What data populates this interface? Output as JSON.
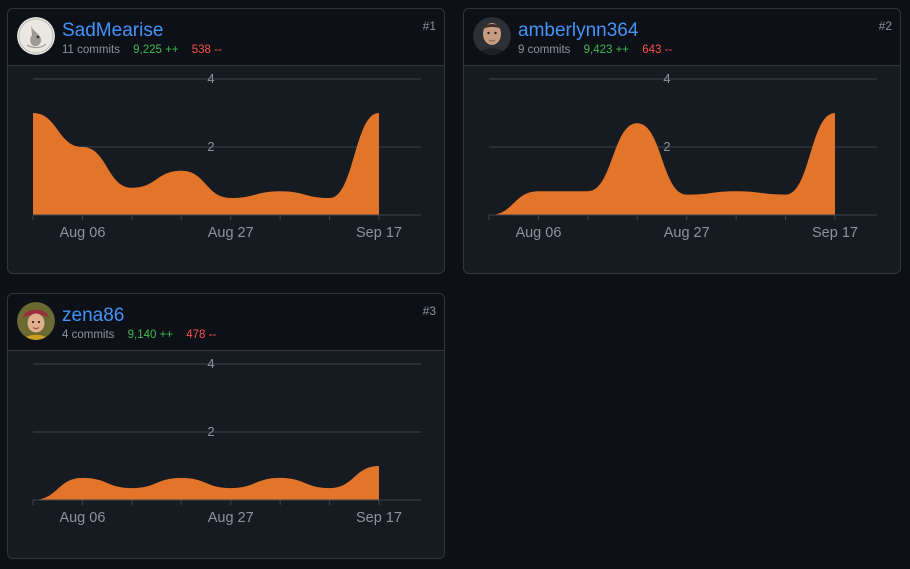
{
  "contributors": [
    {
      "username": "SadMearise",
      "commits": "11 commits",
      "additions": "9,225 ++",
      "deletions": "538 --",
      "rank": "#1",
      "chart_data": {
        "type": "area",
        "y_ticks": [
          "4",
          "2"
        ],
        "ylim": [
          0,
          4
        ],
        "x_labels": [
          "Aug 06",
          "Aug 27",
          "Sep 17"
        ],
        "x_label_weeks": [
          1,
          4,
          7
        ],
        "grid": true,
        "values": [
          3,
          2,
          0.8,
          1.3,
          0.5,
          0.7,
          0.5,
          3
        ],
        "color": "#e3752b"
      }
    },
    {
      "username": "amberlynn364",
      "commits": "9 commits",
      "additions": "9,423 ++",
      "deletions": "643 --",
      "rank": "#2",
      "chart_data": {
        "type": "area",
        "y_ticks": [
          "4",
          "2"
        ],
        "ylim": [
          0,
          4
        ],
        "x_labels": [
          "Aug 06",
          "Aug 27",
          "Sep 17"
        ],
        "x_label_weeks": [
          1,
          4,
          7
        ],
        "grid": true,
        "values": [
          0,
          0.7,
          0.7,
          2.7,
          0.6,
          0.7,
          0.6,
          3
        ],
        "color": "#e3752b"
      }
    },
    {
      "username": "zena86",
      "commits": "4 commits",
      "additions": "9,140 ++",
      "deletions": "478 --",
      "rank": "#3",
      "chart_data": {
        "type": "area",
        "y_ticks": [
          "4",
          "2"
        ],
        "ylim": [
          0,
          4
        ],
        "x_labels": [
          "Aug 06",
          "Aug 27",
          "Sep 17"
        ],
        "x_label_weeks": [
          1,
          4,
          7
        ],
        "grid": true,
        "values": [
          0,
          0.65,
          0.35,
          0.65,
          0.35,
          0.65,
          0.35,
          1
        ],
        "color": "#e3752b"
      }
    }
  ],
  "colors": {
    "background": "#0d1117",
    "card": "#161b22",
    "border": "#30363d",
    "link": "#4493f8",
    "additions": "#3fb950",
    "deletions": "#f85149",
    "area": "#e3752b"
  }
}
